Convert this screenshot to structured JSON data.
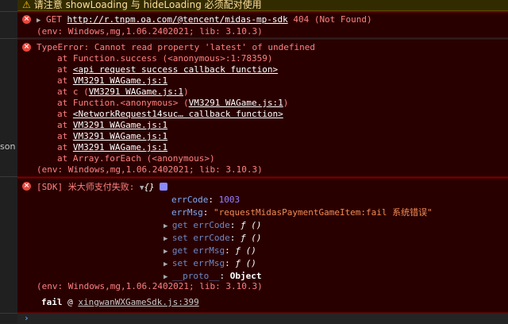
{
  "warning": {
    "icon": "warning-icon",
    "text": "请注意 showLoading 与 hideLoading 必须配对使用"
  },
  "gutter": {
    "cut_text": "son"
  },
  "error1": {
    "prefix": "GET ",
    "url": "http://r.tnpm.oa.com/@tencent/midas-mp-sdk",
    "status": " 404 (Not Found)",
    "env": "(env: Windows,mg,1.06.2402021; lib: 3.10.3)"
  },
  "error2": {
    "message": "TypeError: Cannot read property 'latest' of undefined",
    "stack": [
      {
        "pre": "at Function.success (<anonymous>:1:78359)",
        "link": "",
        "post": ""
      },
      {
        "pre": "at ",
        "link": "<api request success callback function>",
        "post": ""
      },
      {
        "pre": "at ",
        "link": "VM3291 WAGame.js:1",
        "post": ""
      },
      {
        "pre": "at c (",
        "link": "VM3291 WAGame.js:1",
        "post": ")"
      },
      {
        "pre": "at Function.<anonymous> (",
        "link": "VM3291 WAGame.js:1",
        "post": ")"
      },
      {
        "pre": "at ",
        "link": "<NetworkRequest14suc… callback function>",
        "post": ""
      },
      {
        "pre": "at ",
        "link": "VM3291 WAGame.js:1",
        "post": ""
      },
      {
        "pre": "at ",
        "link": "VM3291 WAGame.js:1",
        "post": ""
      },
      {
        "pre": "at ",
        "link": "VM3291 WAGame.js:1",
        "post": ""
      },
      {
        "pre": "at Array.forEach (<anonymous>)",
        "link": "",
        "post": ""
      }
    ],
    "env": "(env: Windows,mg,1.06.2402021; lib: 3.10.3)"
  },
  "error3": {
    "label": "[SDK] 米大师支付失败: ",
    "obj": "{}",
    "props": [
      {
        "key": "errCode",
        "sep": ": ",
        "value": "1003",
        "kind": "num"
      },
      {
        "key": "errMsg",
        "sep": ": ",
        "value": "\"requestMidasPaymentGameItem:fail 系统错误\"",
        "kind": "str"
      }
    ],
    "accessors": [
      {
        "key": "get errCode",
        "value": "ƒ ()"
      },
      {
        "key": "set errCode",
        "value": "ƒ ()"
      },
      {
        "key": "get errMsg",
        "value": "ƒ ()"
      },
      {
        "key": "set errMsg",
        "value": "ƒ ()"
      },
      {
        "key": "__proto__",
        "value": "Object"
      }
    ],
    "env": "(env: Windows,mg,1.06.2402021; lib: 3.10.3)",
    "fail_label": "fail",
    "fail_at": " @ ",
    "fail_link": "xingwanWXGameSdk.js:399"
  },
  "prompt": {
    "symbol": "›"
  }
}
